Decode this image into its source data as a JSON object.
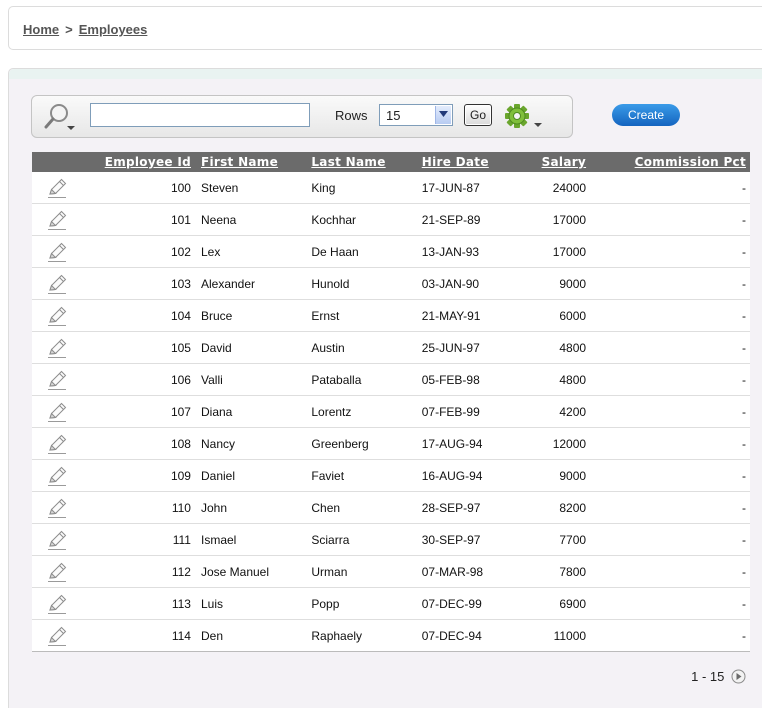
{
  "breadcrumb": {
    "home": "Home",
    "separator": ">",
    "current": "Employees"
  },
  "toolbar": {
    "search_value": "",
    "rows_label": "Rows",
    "rows_value": "15",
    "go_label": "Go",
    "search_icon": "search-icon",
    "actions_icon": "gear-icon"
  },
  "create_label": "Create",
  "columns": [
    "Employee Id",
    "First Name",
    "Last Name",
    "Hire Date",
    "Salary",
    "Commission Pct"
  ],
  "rows": [
    [
      "100",
      "Steven",
      "King",
      "17-JUN-87",
      "24000",
      "-"
    ],
    [
      "101",
      "Neena",
      "Kochhar",
      "21-SEP-89",
      "17000",
      "-"
    ],
    [
      "102",
      "Lex",
      "De Haan",
      "13-JAN-93",
      "17000",
      "-"
    ],
    [
      "103",
      "Alexander",
      "Hunold",
      "03-JAN-90",
      "9000",
      "-"
    ],
    [
      "104",
      "Bruce",
      "Ernst",
      "21-MAY-91",
      "6000",
      "-"
    ],
    [
      "105",
      "David",
      "Austin",
      "25-JUN-97",
      "4800",
      "-"
    ],
    [
      "106",
      "Valli",
      "Pataballa",
      "05-FEB-98",
      "4800",
      "-"
    ],
    [
      "107",
      "Diana",
      "Lorentz",
      "07-FEB-99",
      "4200",
      "-"
    ],
    [
      "108",
      "Nancy",
      "Greenberg",
      "17-AUG-94",
      "12000",
      "-"
    ],
    [
      "109",
      "Daniel",
      "Faviet",
      "16-AUG-94",
      "9000",
      "-"
    ],
    [
      "110",
      "John",
      "Chen",
      "28-SEP-97",
      "8200",
      "-"
    ],
    [
      "111",
      "Ismael",
      "Sciarra",
      "30-SEP-97",
      "7700",
      "-"
    ],
    [
      "112",
      "Jose Manuel",
      "Urman",
      "07-MAR-98",
      "7800",
      "-"
    ],
    [
      "113",
      "Luis",
      "Popp",
      "07-DEC-99",
      "6900",
      "-"
    ],
    [
      "114",
      "Den",
      "Raphaely",
      "07-DEC-94",
      "11000",
      "-"
    ]
  ],
  "pagination": {
    "range": "1 - 15",
    "next_icon": "next-page-icon"
  },
  "colors": {
    "header_bg": "#6b6b6b",
    "create_button": "#1a6fcf",
    "region_bg": "#f4f2f6"
  }
}
